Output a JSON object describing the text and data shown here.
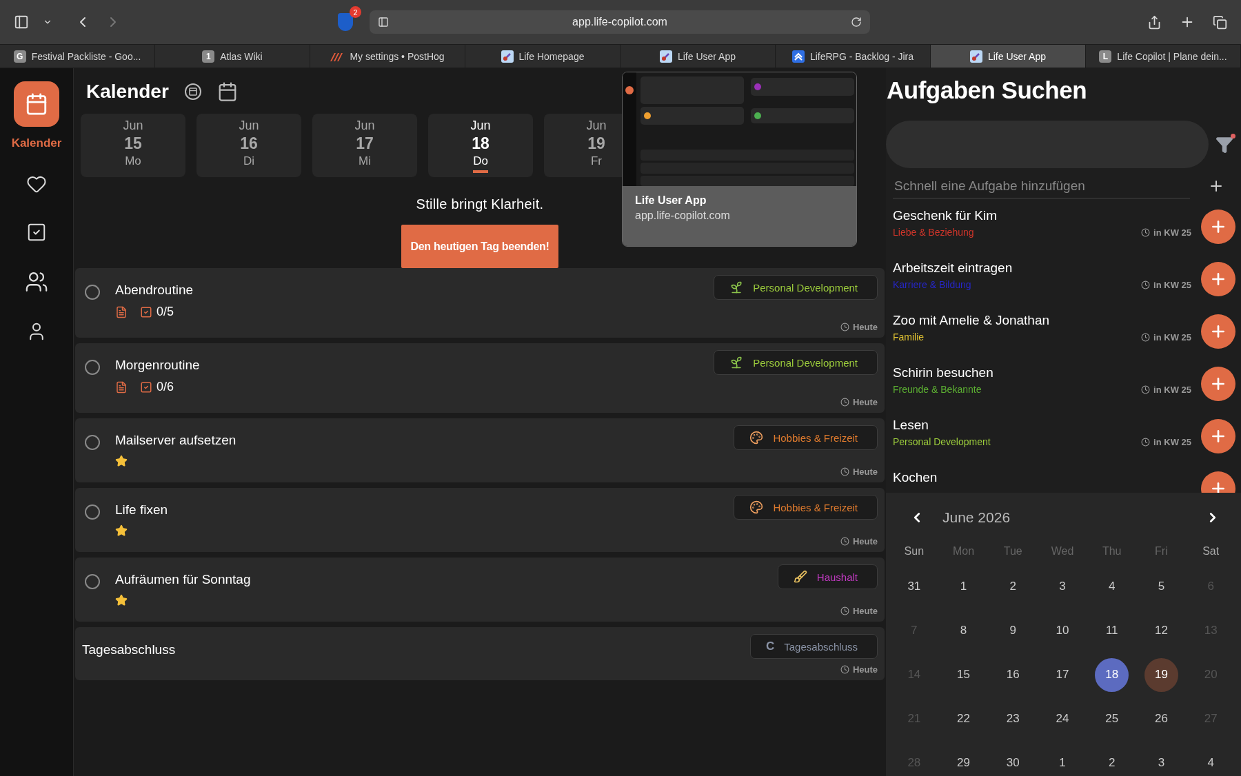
{
  "browser": {
    "bitwarden_badge": "2",
    "address": "app.life-copilot.com",
    "tabs": [
      {
        "title": "Festival Packliste - Goo...",
        "kind": "letter",
        "favicon_text": "G",
        "selected": false
      },
      {
        "title": "Atlas Wiki",
        "kind": "letter",
        "favicon_text": "1",
        "selected": false
      },
      {
        "title": "My settings • PostHog",
        "kind": "posthog",
        "selected": false
      },
      {
        "title": "Life Homepage",
        "kind": "app",
        "selected": false
      },
      {
        "title": "Life User App",
        "kind": "app",
        "selected": false
      },
      {
        "title": "LifeRPG - Backlog - Jira",
        "kind": "jira",
        "selected": false
      },
      {
        "title": "Life User App",
        "kind": "app",
        "selected": true
      },
      {
        "title": "Life Copilot | Plane dein...",
        "kind": "letter",
        "favicon_text": "L",
        "selected": false
      }
    ]
  },
  "sidebar": {
    "items": [
      {
        "kind": "calendar",
        "label": "Kalender",
        "selected": true
      },
      {
        "kind": "heart",
        "selected": false
      },
      {
        "kind": "tasks",
        "selected": false
      },
      {
        "kind": "people",
        "selected": false
      },
      {
        "kind": "profile",
        "selected": false
      }
    ]
  },
  "calendar_view": {
    "title": "Kalender",
    "days": [
      {
        "month": "Jun",
        "day": "15",
        "weekday": "Mo",
        "selected": false
      },
      {
        "month": "Jun",
        "day": "16",
        "weekday": "Di",
        "selected": false
      },
      {
        "month": "Jun",
        "day": "17",
        "weekday": "Mi",
        "selected": false
      },
      {
        "month": "Jun",
        "day": "18",
        "weekday": "Do",
        "selected": true
      },
      {
        "month": "Jun",
        "day": "19",
        "weekday": "Fr",
        "selected": false
      }
    ],
    "quote": "Stille bringt Klarheit.",
    "end_day_button": "Den heutigen Tag beenden!",
    "tasks": [
      {
        "kind": "task",
        "title": "Abendroutine",
        "checked": false,
        "has_note": true,
        "subtasks": "0/5",
        "tag": {
          "label": "Personal Development",
          "kind": "sprout",
          "color": "#9ccc3c"
        },
        "due": "Heute"
      },
      {
        "kind": "task",
        "title": "Morgenroutine",
        "checked": false,
        "has_note": true,
        "subtasks": "0/6",
        "tag": {
          "label": "Personal Development",
          "kind": "sprout",
          "color": "#9ccc3c"
        },
        "due": "Heute"
      },
      {
        "kind": "task",
        "title": "Mailserver aufsetzen",
        "checked": false,
        "starred": true,
        "tag": {
          "label": "Hobbies & Freizeit",
          "kind": "palette",
          "color": "#e07b2e"
        },
        "due": "Heute"
      },
      {
        "kind": "task",
        "title": "Life fixen",
        "checked": false,
        "starred": true,
        "tag": {
          "label": "Hobbies & Freizeit",
          "kind": "palette",
          "color": "#e07b2e"
        },
        "due": "Heute"
      },
      {
        "kind": "task",
        "title": "Aufräumen für Sonntag",
        "checked": false,
        "starred": true,
        "tag": {
          "label": "Haushalt",
          "kind": "broom",
          "color": "#c23ac2"
        },
        "due": "Heute"
      },
      {
        "kind": "summary",
        "title": "Tagesabschluss",
        "tag": {
          "label": "Tagesabschluss",
          "kind": "letter",
          "icon_text": "C",
          "color": "#8a93a6"
        },
        "due": "Heute"
      }
    ]
  },
  "tab_preview": {
    "title": "Life User App",
    "url": "app.life-copilot.com"
  },
  "task_search": {
    "title": "Aufgaben Suchen",
    "filter_active": true,
    "quick_add_placeholder": "Schnell eine Aufgabe hinzufügen",
    "results": [
      {
        "title": "Geschenk für Kim",
        "category": "Liebe & Beziehung",
        "color": "#d0352a",
        "due": "in KW 25"
      },
      {
        "title": "Arbeitszeit eintragen",
        "category": "Karriere & Bildung",
        "color": "#2626c8",
        "due": "in KW 25"
      },
      {
        "title": "Zoo mit Amelie & Jonathan",
        "category": "Familie",
        "color": "#e0c232",
        "due": "in KW 25"
      },
      {
        "title": "Schirin besuchen",
        "category": "Freunde & Bekannte",
        "color": "#5cb032",
        "due": "in KW 25"
      },
      {
        "title": "Lesen",
        "category": "Personal Development",
        "color": "#9ccc3c",
        "due": "in KW 25"
      },
      {
        "title": "Kochen"
      }
    ]
  },
  "date_picker": {
    "month": "June 2026",
    "weekdays": [
      {
        "label": "Sun",
        "muted": false
      },
      {
        "label": "Mon",
        "muted": true
      },
      {
        "label": "Tue",
        "muted": true
      },
      {
        "label": "Wed",
        "muted": true
      },
      {
        "label": "Thu",
        "muted": true
      },
      {
        "label": "Fri",
        "muted": true
      },
      {
        "label": "Sat",
        "muted": false
      }
    ],
    "weeks": [
      [
        {
          "label": "31",
          "muted": false
        },
        {
          "label": "1",
          "muted": false
        },
        {
          "label": "2",
          "muted": false
        },
        {
          "label": "3",
          "muted": false
        },
        {
          "label": "4",
          "muted": false
        },
        {
          "label": "5",
          "muted": false
        },
        {
          "label": "6",
          "muted": true
        }
      ],
      [
        {
          "label": "7",
          "muted": true
        },
        {
          "label": "8",
          "muted": false
        },
        {
          "label": "9",
          "muted": false
        },
        {
          "label": "10",
          "muted": false
        },
        {
          "label": "11",
          "muted": false
        },
        {
          "label": "12",
          "muted": false
        },
        {
          "label": "13",
          "muted": true
        }
      ],
      [
        {
          "label": "14",
          "muted": true
        },
        {
          "label": "15",
          "muted": false
        },
        {
          "label": "16",
          "muted": false
        },
        {
          "label": "17",
          "muted": false
        },
        {
          "label": "18",
          "muted": false,
          "color": "#5c6bc0"
        },
        {
          "label": "19",
          "muted": false,
          "color": "#5b3b2f"
        },
        {
          "label": "20",
          "muted": true
        }
      ],
      [
        {
          "label": "21",
          "muted": true
        },
        {
          "label": "22",
          "muted": false
        },
        {
          "label": "23",
          "muted": false
        },
        {
          "label": "24",
          "muted": false
        },
        {
          "label": "25",
          "muted": false
        },
        {
          "label": "26",
          "muted": false
        },
        {
          "label": "27",
          "muted": true
        }
      ],
      [
        {
          "label": "28",
          "muted": true
        },
        {
          "label": "29",
          "muted": false
        },
        {
          "label": "30",
          "muted": false
        },
        {
          "label": "1",
          "muted": false
        },
        {
          "label": "2",
          "muted": false
        },
        {
          "label": "3",
          "muted": false
        },
        {
          "label": "4",
          "muted": false
        }
      ]
    ]
  }
}
